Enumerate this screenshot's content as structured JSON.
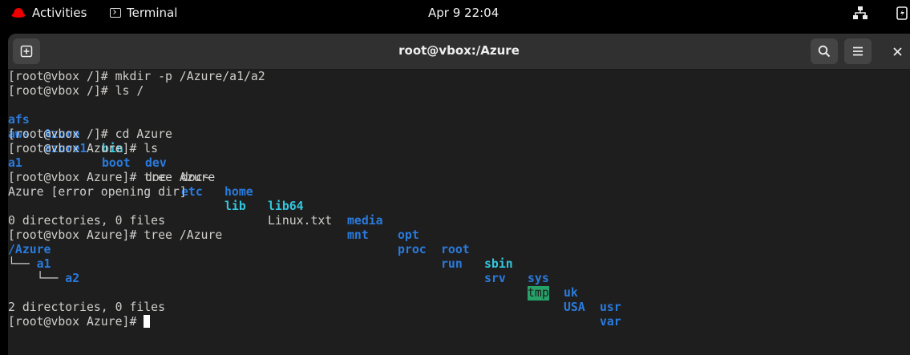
{
  "topbar": {
    "activities_label": "Activities",
    "app_label": "Terminal",
    "clock": "Apr 9  22:04",
    "icons": [
      "redhat-icon",
      "terminal-icon",
      "network-icon",
      "power-icon"
    ]
  },
  "window": {
    "title": "root@vbox:/Azure",
    "buttons": [
      "new-tab-icon",
      "search-icon",
      "hamburger-menu-icon",
      "close-icon"
    ]
  },
  "terminal": {
    "lines": {
      "l1": "[root@vbox /]# mkdir -p /Azure/a1/a2",
      "l2": "[root@vbox /]# ls /",
      "l5": "[root@vbox /]# cd Azure",
      "l6": "[root@vbox Azure]# ls",
      "l7": "a1",
      "l8": "[root@vbox Azure]# tree Azure",
      "l9": "Azure [error opening dir]",
      "l10": "",
      "l11": "0 directories, 0 files",
      "l12": "[root@vbox Azure]# tree /Azure",
      "l13": "/Azure",
      "l14_prefix": "└── ",
      "l14_name": "a1",
      "l15_prefix": "    └── ",
      "l15_name": "a2",
      "l16": "",
      "l17": "2 directories, 0 files",
      "l18": "[root@vbox Azure]# "
    },
    "ls_row1": [
      "afs",
      "Azure",
      "bin",
      "dev",
      "doc~",
      "home",
      "lib64",
      "media",
      "opt",
      "root",
      "sbin",
      "sys",
      "uk",
      "usr"
    ],
    "ls_row2": [
      "aws",
      "azure1",
      "boot",
      "doc",
      "etc",
      "lib",
      "Linux.txt",
      "mnt",
      "proc",
      "run",
      "srv",
      "tmp",
      "USA",
      "var"
    ]
  }
}
